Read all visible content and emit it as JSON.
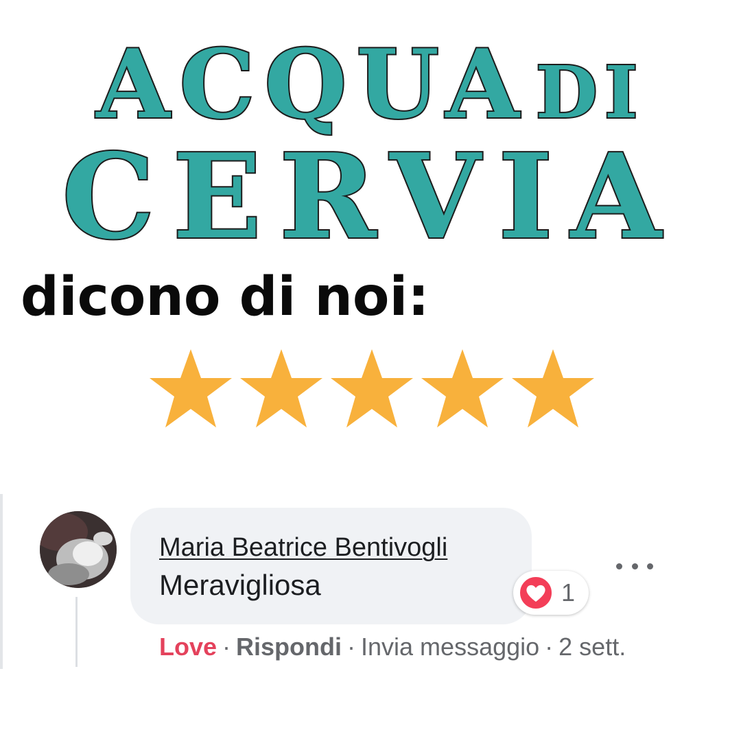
{
  "logo": {
    "line1_main": "ACQUA",
    "line1_small": "DI",
    "line2": "CERVIA",
    "fill_color": "#33a8a2",
    "outline_color": "#1c1c1c"
  },
  "headline": "dicono di noi:",
  "rating": {
    "value": 5,
    "max": 5,
    "star_color": "#f8b13c"
  },
  "comment": {
    "author": "Maria Beatrice Bentivogli",
    "text": "Meravigliosa",
    "reaction": {
      "icon": "heart-love-icon",
      "count": "1",
      "color": "#f33e58"
    },
    "more_icon": "ellipsis-icon",
    "actions": {
      "love": "Love",
      "reply": "Rispondi",
      "send_message": "Invia messaggio",
      "time": "2 sett.",
      "separator": "·"
    }
  }
}
